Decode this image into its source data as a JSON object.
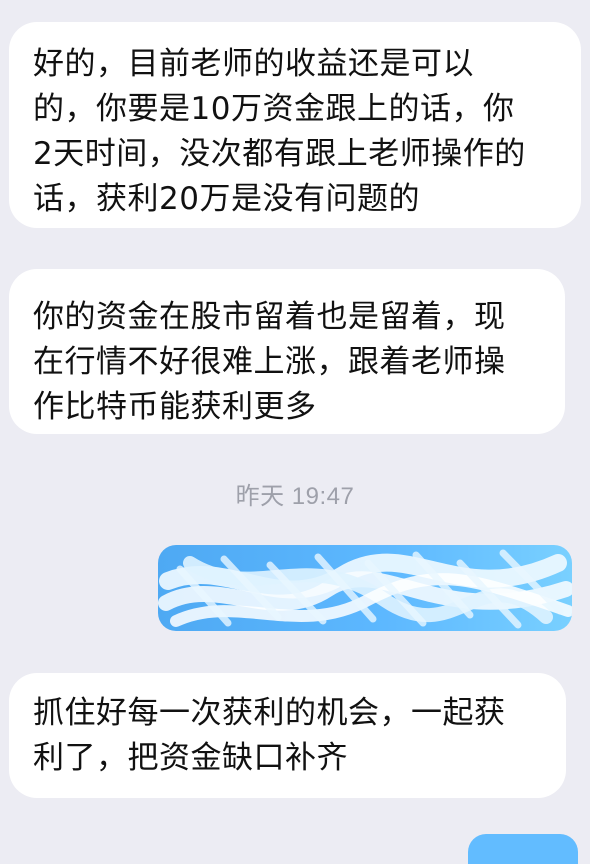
{
  "conversation": {
    "messages": [
      {
        "sender": "incoming",
        "lines": [
          "好的，目前老师的收益还是可以",
          "的，你要是10万资金跟上的话，你",
          "2天时间，没次都有跟上老师操作的",
          "话，获利20万是没有问题的"
        ]
      },
      {
        "sender": "incoming",
        "lines": [
          "你的资金在股市留着也是留着，现",
          "在行情不好很难上涨，跟着老师操",
          "作比特币能获利更多"
        ]
      },
      {
        "sender": "incoming",
        "lines": [
          "抓住好每一次获利的机会，一起获",
          "利了，把资金缺口补齐"
        ]
      }
    ],
    "timestamp": "昨天 19:47"
  },
  "theme": {
    "background": "#ececf3",
    "incoming_bubble": "#ffffff",
    "outgoing_bubble": "#5db8ff",
    "timestamp_color": "#9ea0aa"
  }
}
